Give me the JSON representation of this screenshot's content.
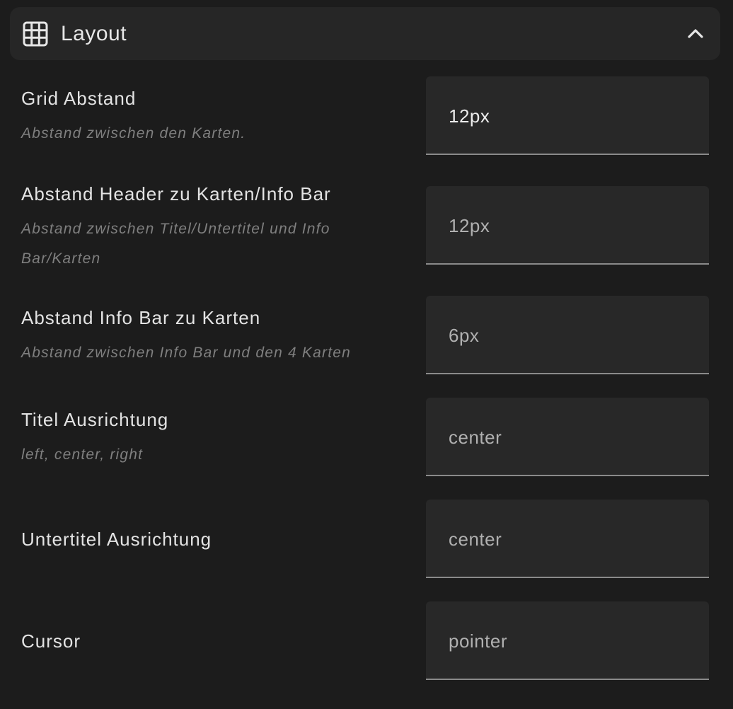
{
  "section": {
    "title": "Layout",
    "icon": "grid-icon",
    "collapse_icon": "chevron-up-icon"
  },
  "fields": [
    {
      "label": "Grid Abstand",
      "description": "Abstand zwischen den Karten.",
      "value": "12px"
    },
    {
      "label": "Abstand Header zu Karten/Info Bar",
      "description": "Abstand zwischen Titel/Untertitel und Info Bar/Karten",
      "value": "12px"
    },
    {
      "label": "Abstand Info Bar zu Karten",
      "description": "Abstand zwischen Info Bar und den 4 Karten",
      "value": "6px"
    },
    {
      "label": "Titel Ausrichtung",
      "description": "left, center, right",
      "value": "center"
    },
    {
      "label": "Untertitel Ausrichtung",
      "description": "",
      "value": "center"
    },
    {
      "label": "Cursor",
      "description": "",
      "value": "pointer"
    }
  ],
  "colors": {
    "background": "#1c1c1c",
    "header_bg": "#262626",
    "field_bg": "#282828",
    "label": "#e3e3e3",
    "description": "#7f7f7f",
    "field_border": "#8a8a8a"
  }
}
